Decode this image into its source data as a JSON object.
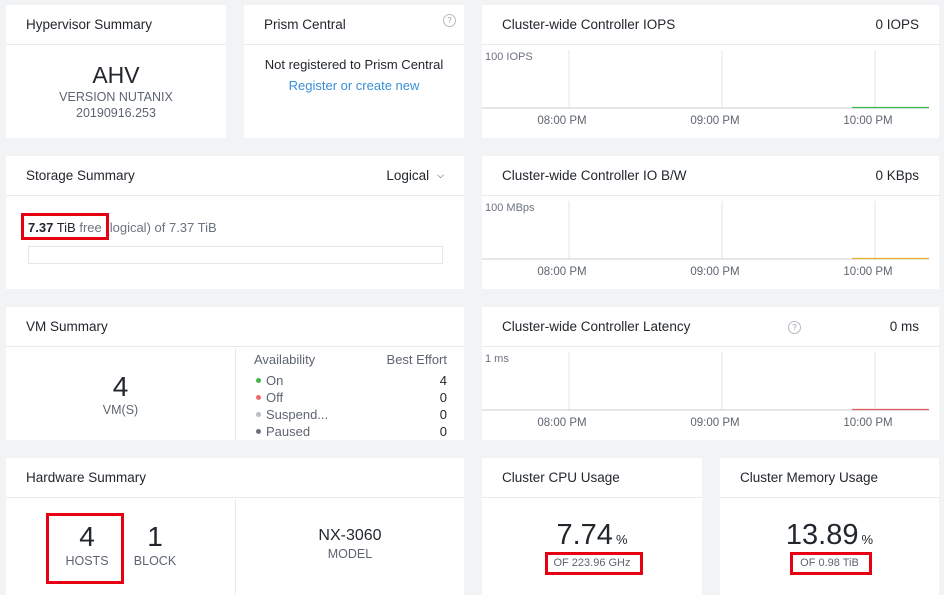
{
  "hypervisor": {
    "title": "Hypervisor Summary",
    "name": "AHV",
    "version_line1": "VERSION NUTANIX",
    "version_line2": "20190916.253"
  },
  "prism": {
    "title": "Prism Central",
    "status": "Not registered to Prism Central",
    "link": "Register or create new",
    "help_icon": "question-circle-icon"
  },
  "iops": {
    "title": "Cluster-wide Controller IOPS",
    "value": "0 IOPS",
    "ylabel": "100 IOPS",
    "xticks": [
      "08:00 PM",
      "09:00 PM",
      "10:00 PM"
    ],
    "line_color": "#3fb64a"
  },
  "storage": {
    "title": "Storage Summary",
    "view": "Logical",
    "free_value": "7.37",
    "free_unit": "TiB",
    "free_label": "free",
    "rest": "(logical) of 7.37 TiB",
    "used_fraction": 0
  },
  "bw": {
    "title": "Cluster-wide Controller IO B/W",
    "value": "0 KBps",
    "ylabel": "100 MBps",
    "xticks": [
      "08:00 PM",
      "09:00 PM",
      "10:00 PM"
    ],
    "line_color": "#e7b02c"
  },
  "vm": {
    "title": "VM Summary",
    "count": "4",
    "count_label": "VM(S)",
    "col_availability": "Availability",
    "col_best_effort": "Best Effort",
    "rows": [
      {
        "label": "On",
        "value": "4",
        "dot": "#3fb64a"
      },
      {
        "label": "Off",
        "value": "0",
        "dot": "#ef6b6b"
      },
      {
        "label": "Suspend...",
        "value": "0",
        "dot": "#b9bec5"
      },
      {
        "label": "Paused",
        "value": "0",
        "dot": "#6b7380"
      }
    ]
  },
  "latency": {
    "title": "Cluster-wide Controller Latency",
    "value": "0 ms",
    "ylabel": "1 ms",
    "xticks": [
      "08:00 PM",
      "09:00 PM",
      "10:00 PM"
    ],
    "line_color": "#e05a5a",
    "help_icon": "question-circle-icon"
  },
  "hardware": {
    "title": "Hardware Summary",
    "hosts": "4",
    "hosts_label": "HOSTS",
    "blocks": "1",
    "blocks_label": "BLOCK",
    "model": "NX-3060",
    "model_label": "MODEL"
  },
  "cpu": {
    "title": "Cluster CPU Usage",
    "value": "7.74",
    "unit": "%",
    "of": "OF 223.96 GHz"
  },
  "memory": {
    "title": "Cluster Memory Usage",
    "value": "13.89",
    "unit": "%",
    "of": "OF 0.98 TiB"
  },
  "colors": {
    "highlight": "#e60012",
    "link": "#3b8fd9"
  }
}
